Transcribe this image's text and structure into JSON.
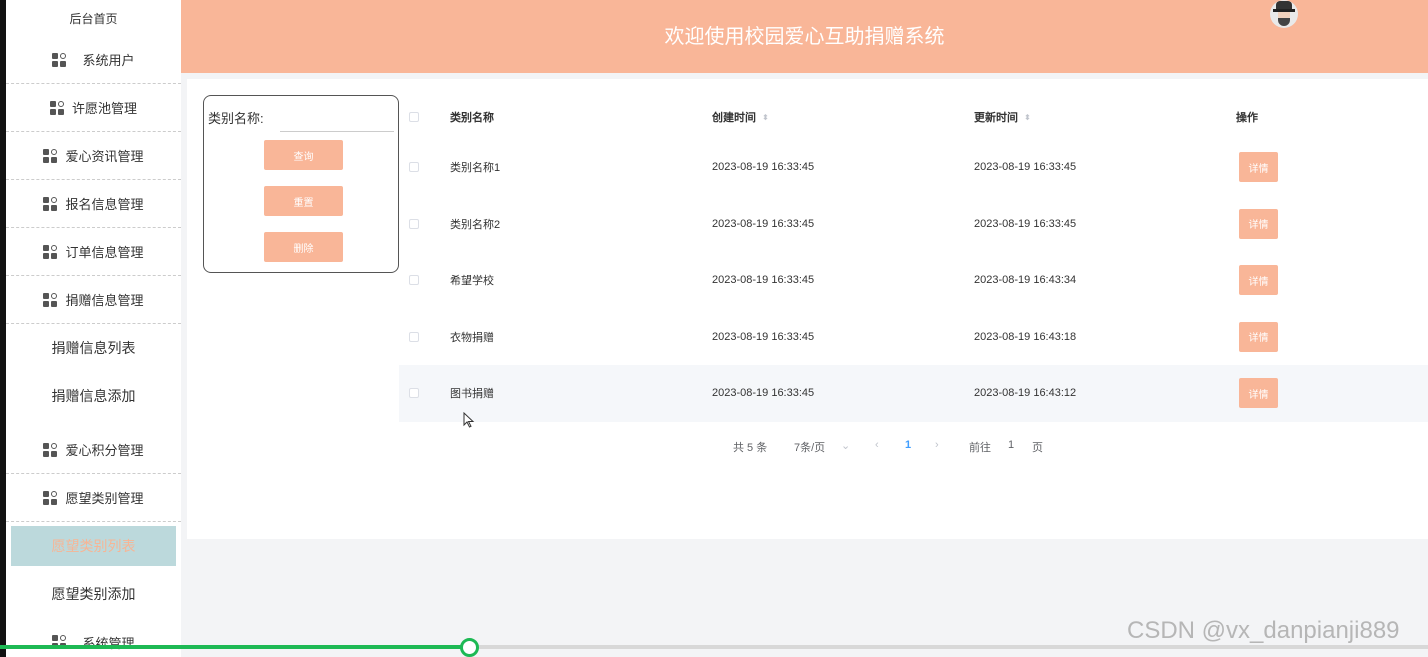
{
  "sidebar": {
    "home": "后台首页",
    "items": [
      {
        "label": "系统用户"
      },
      {
        "label": "许愿池管理"
      },
      {
        "label": "爱心资讯管理"
      },
      {
        "label": "报名信息管理"
      },
      {
        "label": "订单信息管理"
      },
      {
        "label": "捐赠信息管理"
      }
    ],
    "donation_sub": [
      "捐赠信息列表",
      "捐赠信息添加"
    ],
    "items2": [
      {
        "label": "爱心积分管理"
      },
      {
        "label": "愿望类别管理"
      }
    ],
    "wish_sub": [
      "愿望类别列表",
      "愿望类别添加"
    ],
    "system": "系统管理"
  },
  "header": {
    "title": "欢迎使用校园爱心互助捐赠系统"
  },
  "search": {
    "label": "类别名称:",
    "value": "",
    "query_btn": "查询",
    "reset_btn": "重置",
    "delete_btn": "删除"
  },
  "table": {
    "headers": [
      "类别名称",
      "创建时间",
      "更新时间",
      "操作"
    ],
    "rows": [
      {
        "name": "类别名称1",
        "created": "2023-08-19 16:33:45",
        "updated": "2023-08-19 16:33:45",
        "action": "详情"
      },
      {
        "name": "类别名称2",
        "created": "2023-08-19 16:33:45",
        "updated": "2023-08-19 16:33:45",
        "action": "详情"
      },
      {
        "name": "希望学校",
        "created": "2023-08-19 16:33:45",
        "updated": "2023-08-19 16:43:34",
        "action": "详情"
      },
      {
        "name": "衣物捐赠",
        "created": "2023-08-19 16:33:45",
        "updated": "2023-08-19 16:43:18",
        "action": "详情"
      },
      {
        "name": "图书捐赠",
        "created": "2023-08-19 16:33:45",
        "updated": "2023-08-19 16:43:12",
        "action": "详情"
      }
    ]
  },
  "pagination": {
    "total": "共 5 条",
    "page_size": "7条/页",
    "current": "1",
    "goto_prefix": "前往",
    "goto_value": "1",
    "goto_suffix": "页"
  },
  "watermark": "CSDN @vx_danpianji889",
  "video": {
    "progress": 0.33
  },
  "colors": {
    "header": "#f9b698",
    "button": "#f9b698",
    "active_item_bg": "#bcd9dc",
    "progress": "#1db954"
  }
}
